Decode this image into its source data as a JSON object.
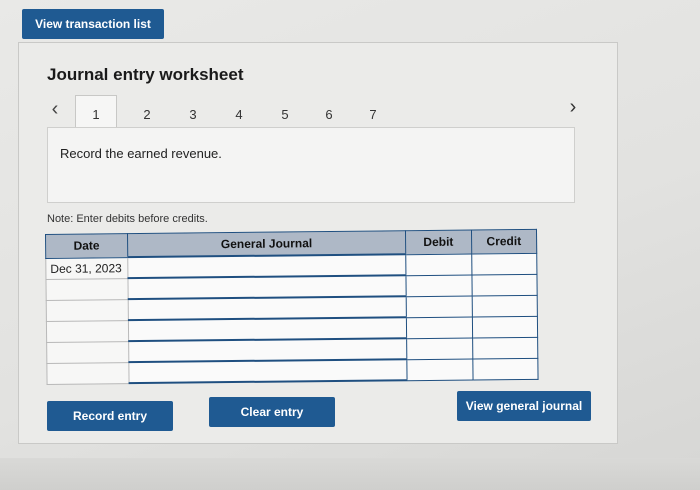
{
  "header": {
    "view_transactions_label": "View transaction list"
  },
  "worksheet": {
    "title": "Journal entry worksheet",
    "nav": {
      "prev_icon": "chevron-left-icon",
      "next_icon": "chevron-right-icon"
    },
    "tabs": [
      "1",
      "2",
      "3",
      "4",
      "5",
      "6",
      "7"
    ],
    "active_tab": "1",
    "prompt": "Record the earned revenue.",
    "note": "Note: Enter debits before credits."
  },
  "journal": {
    "columns": {
      "date": "Date",
      "general_journal": "General Journal",
      "debit": "Debit",
      "credit": "Credit"
    },
    "rows": [
      {
        "date": "Dec 31, 2023",
        "account": "",
        "debit": "",
        "credit": ""
      },
      {
        "date": "",
        "account": "",
        "debit": "",
        "credit": ""
      },
      {
        "date": "",
        "account": "",
        "debit": "",
        "credit": ""
      },
      {
        "date": "",
        "account": "",
        "debit": "",
        "credit": ""
      },
      {
        "date": "",
        "account": "",
        "debit": "",
        "credit": ""
      },
      {
        "date": "",
        "account": "",
        "debit": "",
        "credit": ""
      }
    ]
  },
  "actions": {
    "record_label": "Record entry",
    "clear_label": "Clear entry",
    "view_general_journal_label": "View general journal"
  },
  "colors": {
    "button": "#1f5a92",
    "table_header": "#aeb8c6",
    "grid_line": "#1f4f80"
  }
}
